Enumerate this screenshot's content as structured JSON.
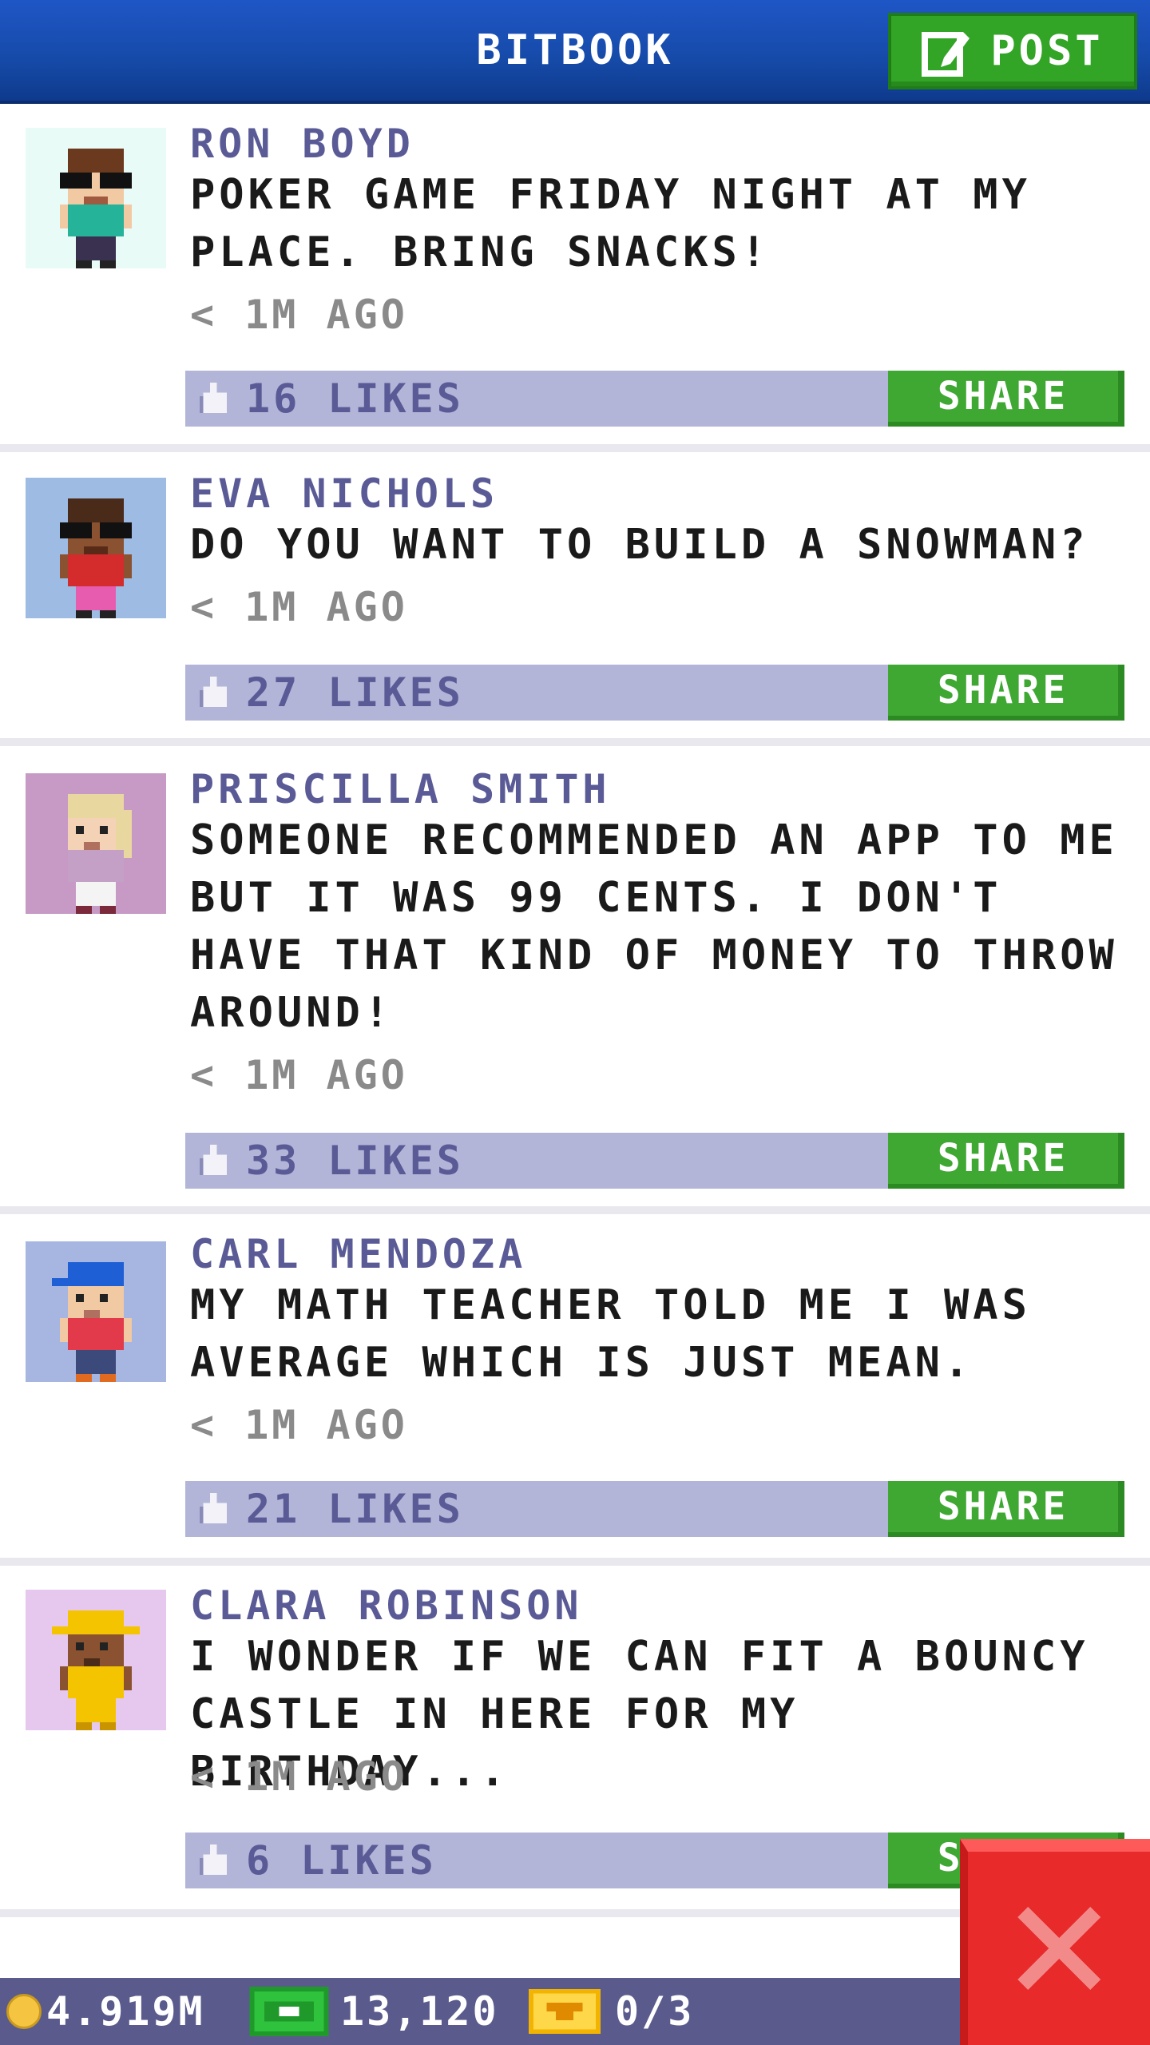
{
  "header": {
    "title": "BITBOOK",
    "post_label": "POST"
  },
  "posts": [
    {
      "author": "RON BOYD",
      "text": "POKER GAME FRIDAY NIGHT AT MY PLACE. BRING SNACKS!",
      "time": "< 1M AGO",
      "likes": "16 LIKES",
      "share": "SHARE",
      "avatar_bg": "#e9fbf7"
    },
    {
      "author": "EVA NICHOLS",
      "text": "DO YOU WANT TO BUILD A SNOWMAN?",
      "time": "< 1M AGO",
      "likes": "27 LIKES",
      "share": "SHARE",
      "avatar_bg": "#9dbbe3"
    },
    {
      "author": "PRISCILLA SMITH",
      "text": "SOMEONE RECOMMENDED AN APP TO ME BUT IT WAS 99 CENTS. I DON'T HAVE THAT KIND OF MONEY TO THROW AROUND!",
      "time": "< 1M AGO",
      "likes": "33 LIKES",
      "share": "SHARE",
      "avatar_bg": "#c79ac5"
    },
    {
      "author": "CARL MENDOZA",
      "text": "MY MATH TEACHER TOLD ME I WAS AVERAGE WHICH IS JUST MEAN.",
      "time": "< 1M AGO",
      "likes": "21 LIKES",
      "share": "SHARE",
      "avatar_bg": "#a6b6e0"
    },
    {
      "author": "CLARA ROBINSON",
      "text": "I WONDER IF WE CAN FIT A BOUNCY CASTLE IN HERE FOR MY BIRTHDAY...",
      "time": "< 1M AGO",
      "likes": "6 LIKES",
      "share": "SHARE",
      "avatar_bg": "#e6c8ee"
    }
  ],
  "status": {
    "coins": "4.919M",
    "bux": "13,120",
    "tickets": "0/3"
  },
  "icons": {
    "post": "compose-icon",
    "like": "thumbs-up-icon",
    "coin": "coin-icon",
    "bux": "bux-icon",
    "ticket": "ticket-icon",
    "close": "close-icon"
  },
  "colors": {
    "header": "#164aa8",
    "accent_green": "#3ea832",
    "like_bar": "#b3b5d8",
    "author": "#5a5a96",
    "close_red": "#e82a2a"
  }
}
